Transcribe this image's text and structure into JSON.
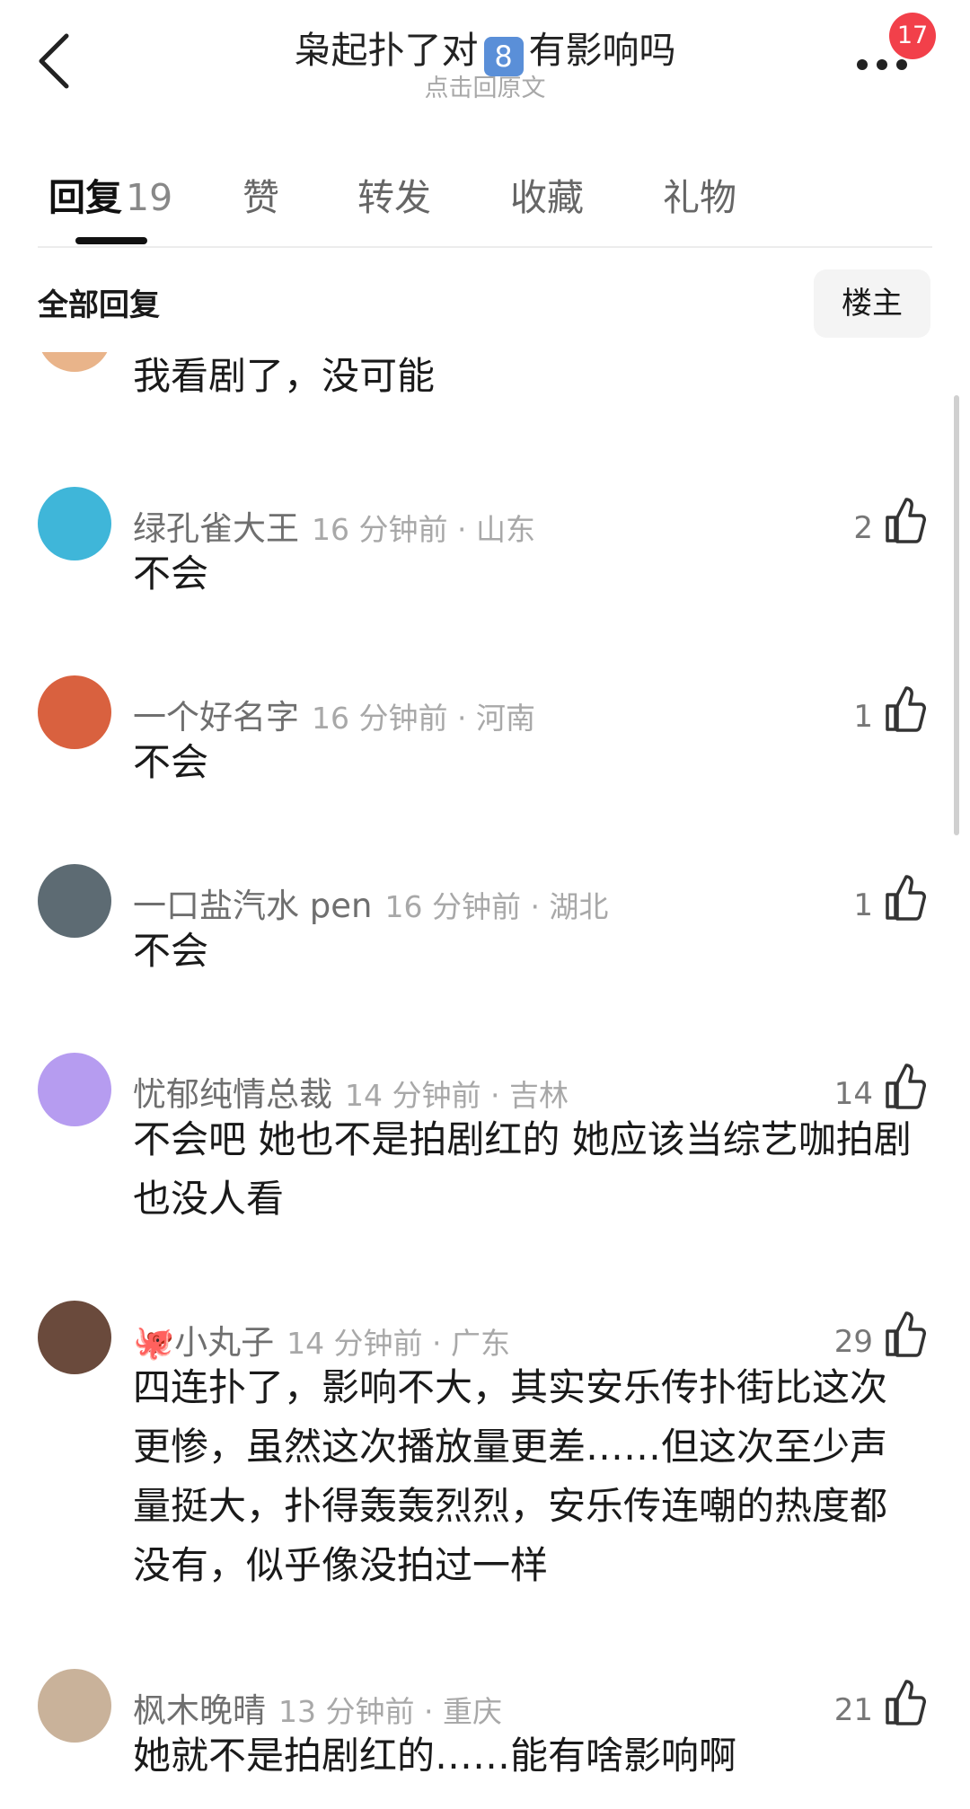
{
  "header": {
    "title_part1": "枭起扑了对",
    "title_badge": "8",
    "title_part2": "有影响吗",
    "subtitle": "点击回原文",
    "notification_count": "17"
  },
  "tabs": [
    {
      "label": "回复",
      "count": "19",
      "active": true
    },
    {
      "label": "赞"
    },
    {
      "label": "转发"
    },
    {
      "label": "收藏"
    },
    {
      "label": "礼物"
    }
  ],
  "subbar": {
    "title": "全部回复",
    "op_button": "楼主"
  },
  "comments": [
    {
      "username": "",
      "time_location": "",
      "likes": "",
      "text": "我看剧了，没可能",
      "avatar_color": "#e9b48a"
    },
    {
      "username": "绿孔雀大王",
      "time_location": "16 分钟前 · 山东",
      "likes": "2",
      "text": "不会",
      "avatar_color": "#3fb6d9"
    },
    {
      "username": "一个好名字",
      "time_location": "16 分钟前 · 河南",
      "likes": "1",
      "text": "不会",
      "avatar_color": "#d9613f"
    },
    {
      "username": "一口盐汽水 pen",
      "time_location": "16 分钟前 · 湖北",
      "likes": "1",
      "text": "不会",
      "avatar_color": "#5d6b73"
    },
    {
      "username": "忧郁纯情总裁",
      "time_location": "14 分钟前 · 吉林",
      "likes": "14",
      "text": "不会吧 她也不是拍剧红的 她应该当综艺咖拍剧也没人看",
      "avatar_color": "#b69cf0"
    },
    {
      "username": "🐙小丸子",
      "time_location": "14 分钟前 · 广东",
      "likes": "29",
      "text": "四连扑了，影响不大，其实安乐传扑街比这次更惨，虽然这次播放量更差……但这次至少声量挺大，扑得轰轰烈烈，安乐传连嘲的热度都没有，似乎像没拍过一样",
      "avatar_color": "#6a4a3c"
    },
    {
      "username": "枫木晚晴",
      "time_location": "13 分钟前 · 重庆",
      "likes": "21",
      "text": "她就不是拍剧红的……能有啥影响啊",
      "avatar_color": "#c9b29a"
    }
  ]
}
